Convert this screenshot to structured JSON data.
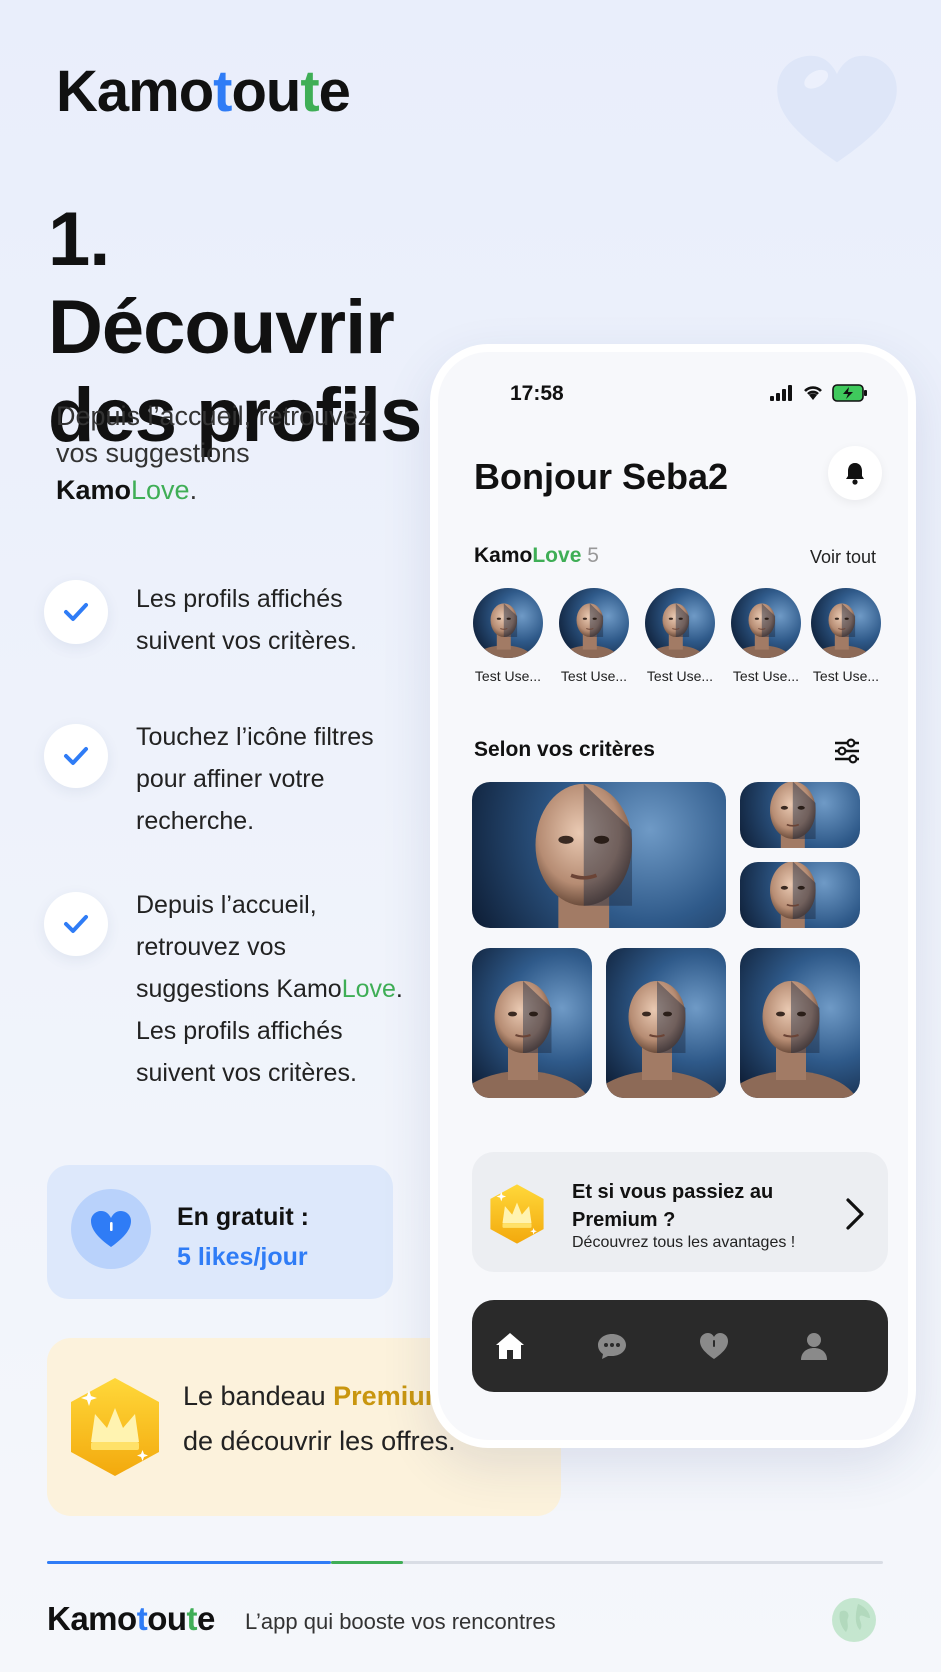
{
  "brand": {
    "logo_parts": [
      "Kamo",
      "t",
      "ou",
      "t",
      "e"
    ],
    "colors": {
      "blue": "#2f7cf6",
      "green": "#3fae56",
      "gold": "#c9960f",
      "dark": "#111111"
    }
  },
  "title": {
    "line1": "1. Découvrir",
    "line2": "des profils"
  },
  "intro": {
    "prefix": "Depuis l’accueil, retrouvez vos suggestions ",
    "kamo": "Kamo",
    "love": "Love",
    "suffix": "."
  },
  "checks": [
    {
      "icon": "checkmark-icon",
      "text": "Les profils affichés suivent vos critères."
    },
    {
      "icon": "checkmark-icon",
      "text": "Touchez l’icône filtres pour affiner votre recherche."
    },
    {
      "icon": "checkmark-icon",
      "text_prefix": "Depuis l’accueil, retrouvez vos suggestions Kamo",
      "love": "Love",
      "text_suffix": ". Les profils affichés suivent vos critères."
    }
  ],
  "free_card": {
    "label": "En gratuit :",
    "value": "5 likes/jour",
    "icon": "heart-icon"
  },
  "premium_info": {
    "prefix": "Le bandeau ",
    "highlight": "Premium",
    "suffix": " permet de découvrir les offres.",
    "icon": "crown-icon"
  },
  "phone": {
    "status": {
      "time": "17:58",
      "icons": [
        "signal-icon",
        "wifi-icon",
        "battery-charging-icon"
      ]
    },
    "greeting": "Bonjour Seba2",
    "bell_icon": "bell-icon",
    "kamolove": {
      "kamo": "Kamo",
      "love": "Love",
      "count": "5",
      "see_all": "Voir tout"
    },
    "stories": [
      {
        "name": "Test Use..."
      },
      {
        "name": "Test Use..."
      },
      {
        "name": "Test Use..."
      },
      {
        "name": "Test Use..."
      },
      {
        "name": "Test Use..."
      }
    ],
    "criteria": {
      "title": "Selon vos critères",
      "filter_icon": "filter-sliders-icon"
    },
    "premium_banner": {
      "title": "Et si vous passiez au Premium ?",
      "subtitle": "Découvrez tous les avantages !",
      "icon": "crown-icon",
      "chevron": "chevron-right-icon"
    },
    "tabbar": [
      {
        "name": "home",
        "icon": "home-icon",
        "active": true
      },
      {
        "name": "messages",
        "icon": "chat-bubble-icon",
        "active": false
      },
      {
        "name": "likes",
        "icon": "heart-icon",
        "active": false
      },
      {
        "name": "profile",
        "icon": "user-icon",
        "active": false
      }
    ]
  },
  "progress": {
    "blue_fraction": 0.34,
    "green_fraction": 0.086
  },
  "footer": {
    "logo_parts": [
      "Kamo",
      "t",
      "ou",
      "t",
      "e"
    ],
    "tagline": "L’app qui booste vos rencontres"
  }
}
